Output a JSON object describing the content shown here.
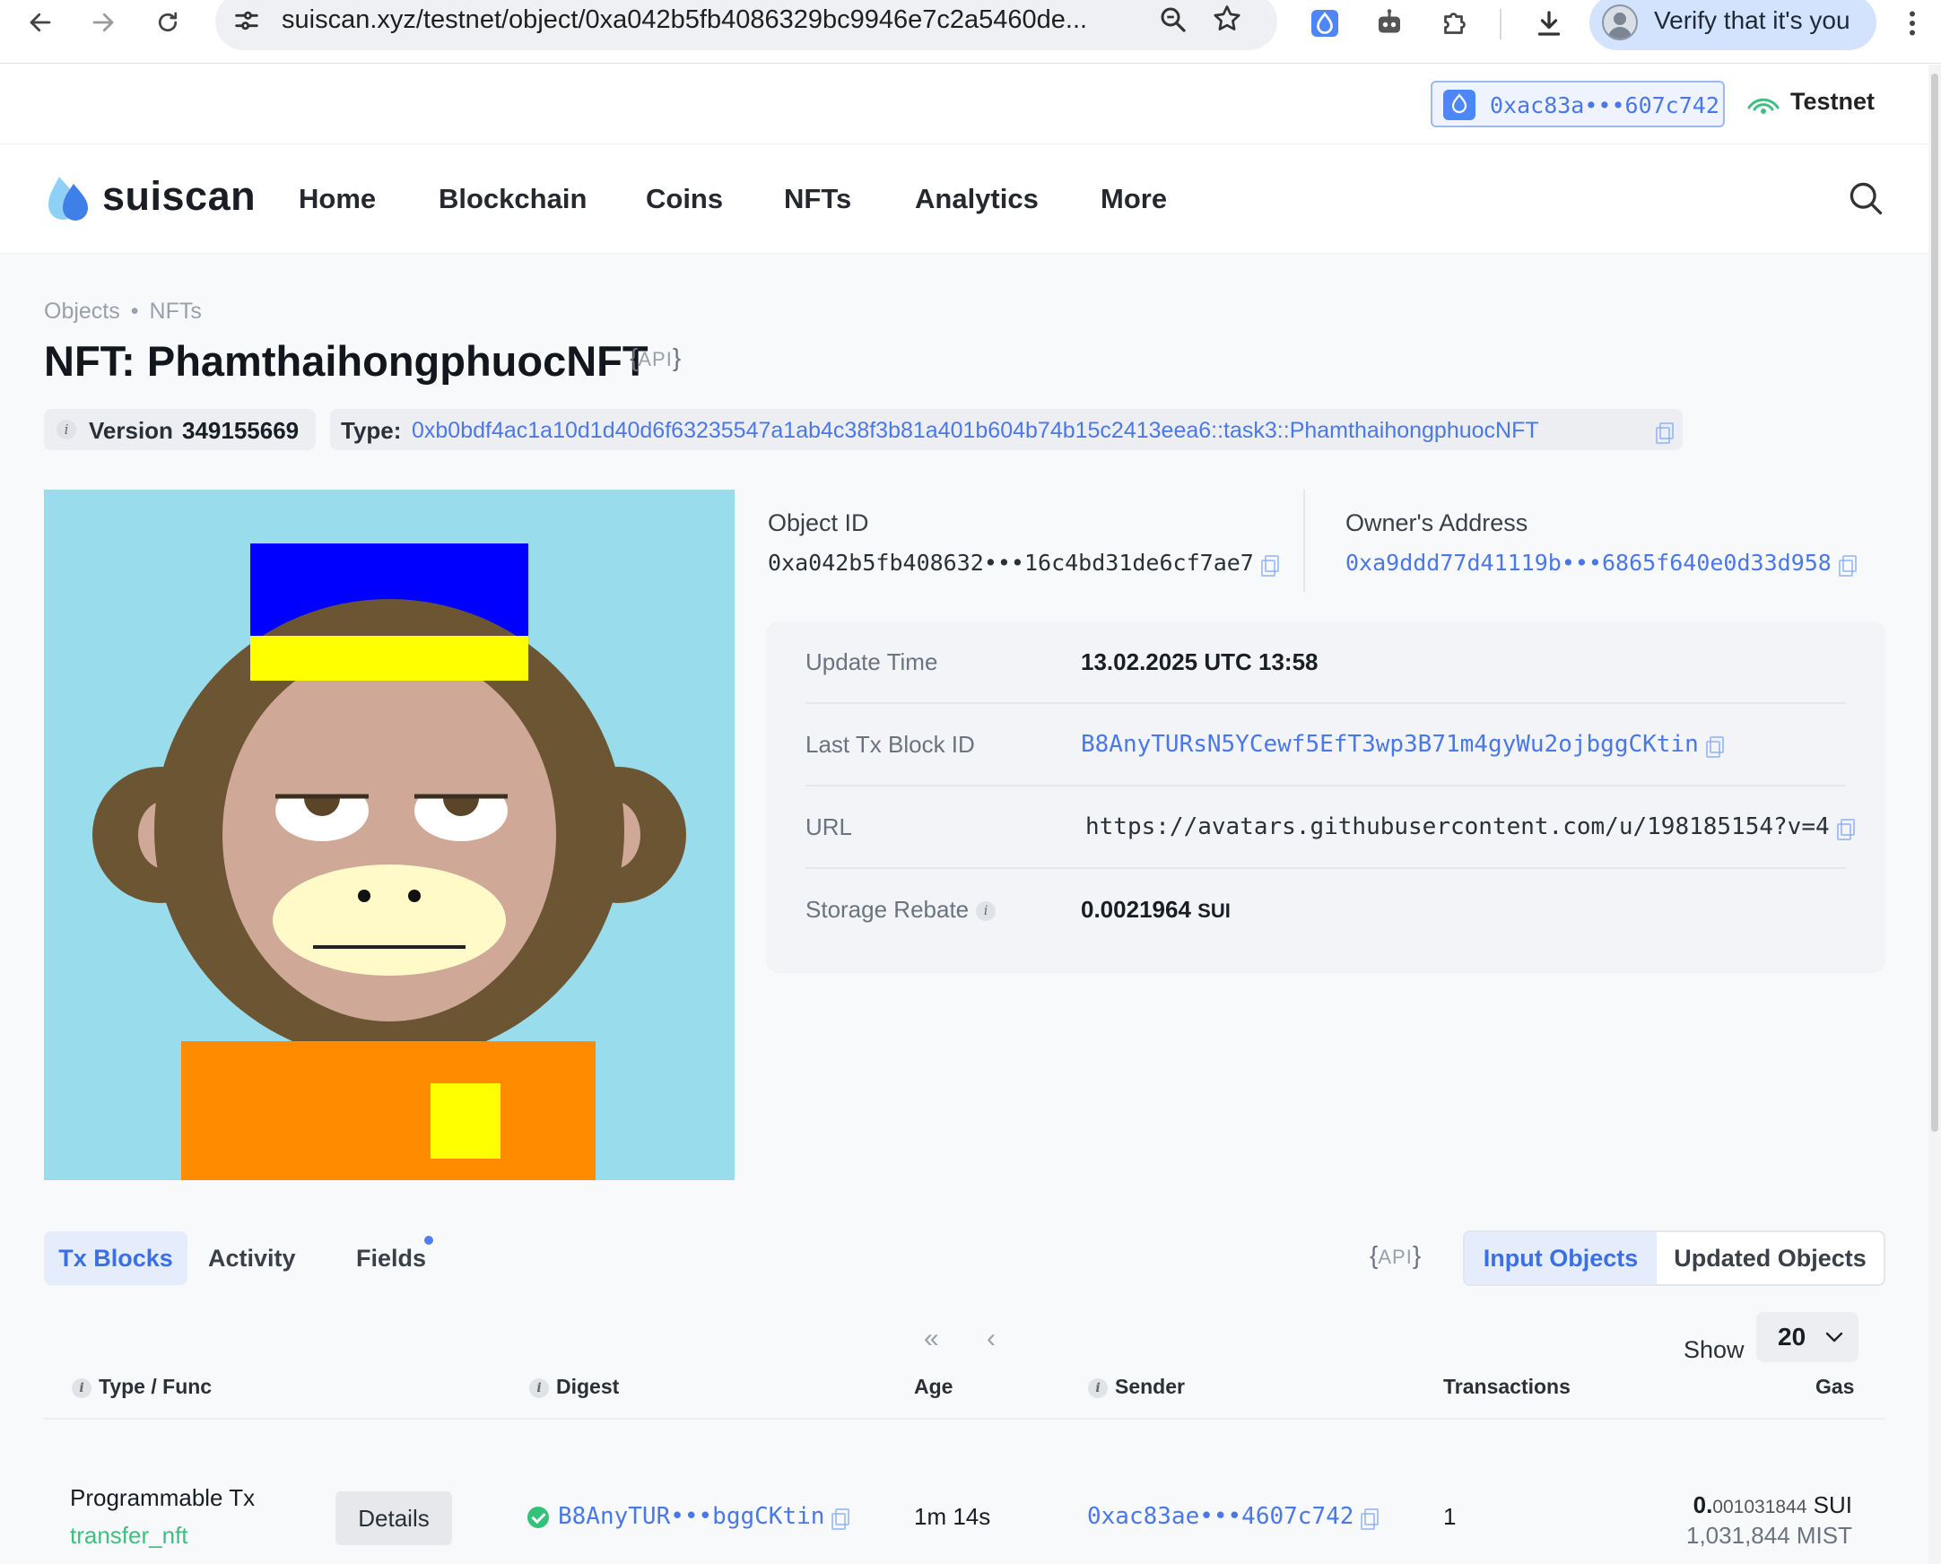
{
  "browser": {
    "url": "suiscan.xyz/testnet/object/0xa042b5fb4086329bc9946e7c2a5460de...",
    "profile_label": "Verify that it's you"
  },
  "topbar": {
    "wallet_address": "0xac83a•••607c742",
    "network": "Testnet"
  },
  "nav": {
    "brand": "suiscan",
    "items": [
      "Home",
      "Blockchain",
      "Coins",
      "NFTs",
      "Analytics",
      "More"
    ]
  },
  "breadcrumb": [
    "Objects",
    "NFTs"
  ],
  "page": {
    "title": "NFT: PhamthaihongphuocNFT",
    "api_label": "API",
    "version_label": "Version",
    "version_value": "349155669",
    "type_label": "Type:",
    "type_value": "0xb0bdf4ac1a10d1d40d6f63235547a1ab4c38f3b81a401b604b74b15c2413eea6::task3::PhamthaihongphuocNFT"
  },
  "object": {
    "object_id_label": "Object ID",
    "object_id": "0xa042b5fb408632•••16c4bd31de6cf7ae7",
    "owner_label": "Owner's Address",
    "owner": "0xa9ddd77d41119b•••6865f640e0d33d958"
  },
  "details": [
    {
      "label": "Update Time",
      "value": "13.02.2025 UTC 13:58"
    },
    {
      "label": "Last Tx Block ID",
      "value": "B8AnyTURsN5YCewf5EfT3wp3B71m4gyWu2ojbggCKtin"
    },
    {
      "label": "URL",
      "value": "https://avatars.githubusercontent.com/u/198185154?v=4"
    },
    {
      "label": "Storage Rebate",
      "value": "0.0021964",
      "unit": "SUI"
    }
  ],
  "tabs": [
    "Tx Blocks",
    "Activity",
    "Fields"
  ],
  "api_label_2": "API",
  "segments": [
    "Input Objects",
    "Updated Objects"
  ],
  "pager": {
    "first": "«",
    "prev": "‹"
  },
  "show": {
    "label": "Show",
    "value": "20"
  },
  "table": {
    "columns": [
      "Type / Func",
      "Digest",
      "Age",
      "Sender",
      "Transactions",
      "Gas"
    ],
    "rows": [
      {
        "type": "Programmable Tx",
        "func": "transfer_nft",
        "details_label": "Details",
        "digest": "B8AnyTUR•••bggCKtin",
        "age": "1m 14s",
        "sender": "0xac83ae•••4607c742",
        "transactions": "1",
        "gas_int": "0.",
        "gas_frac": "001031844",
        "gas_unit": "SUI",
        "gas_mist": "1,031,844 MIST"
      }
    ]
  },
  "colors": {
    "accent": "#4a78e8",
    "func_green": "#3fbf7f",
    "nft_bg": "#99dcec"
  },
  "icons": {
    "back": "arrow-left-icon",
    "forward": "arrow-right-icon",
    "reload": "reload-icon",
    "site_settings": "tune-icon",
    "zoom": "zoom-icon",
    "bookmark": "star-icon",
    "ext_drop": "sui-drop-icon",
    "ext_robot": "robot-icon",
    "ext_puzzle": "puzzle-icon",
    "download": "download-icon",
    "menu": "kebab-icon",
    "network": "signal-icon",
    "search": "search-icon"
  }
}
